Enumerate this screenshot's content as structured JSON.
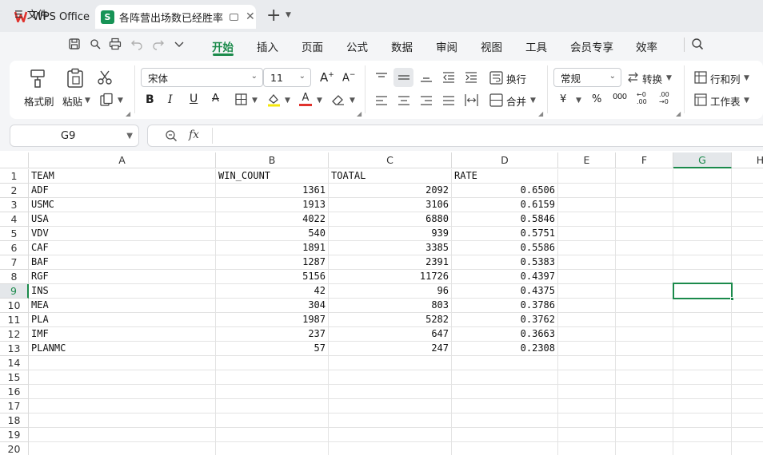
{
  "tabs": {
    "app_label": "WPS Office",
    "doc_label": "各阵营出场数已经胜率",
    "doc_icon_letter": "S"
  },
  "menu": {
    "file_label": "文件",
    "items": [
      "开始",
      "插入",
      "页面",
      "公式",
      "数据",
      "审阅",
      "视图",
      "工具",
      "会员专享",
      "效率"
    ]
  },
  "ribbon": {
    "format_painter": "格式刷",
    "paste": "粘贴",
    "font_name": "宋体",
    "font_size": "11",
    "wrap": "换行",
    "merge": "合并",
    "number_format": "常规",
    "convert": "转换",
    "rows_cols": "行和列",
    "worksheet": "工作表",
    "bold": "B",
    "italic": "I",
    "underline": "U",
    "strike": "A",
    "percent": "%",
    "thousands": "000",
    "currency": "¥",
    "inc_decimal": "←0 .00",
    "dec_decimal": ".00 →0",
    "grow_font": "A",
    "shrink_font": "A",
    "font_color_letter": "A"
  },
  "formula_bar": {
    "cell_ref": "G9",
    "fx": "fx",
    "content": ""
  },
  "sheet": {
    "columns": [
      "A",
      "B",
      "C",
      "D",
      "E",
      "F",
      "G",
      "H"
    ],
    "selected_column": "G",
    "selected_row": 9,
    "row_numbers": [
      "1",
      "2",
      "3",
      "4",
      "5",
      "6",
      "7",
      "8",
      "9",
      "10",
      "11",
      "12",
      "13",
      "14",
      "15",
      "16",
      "17",
      "18",
      "19",
      "20"
    ],
    "header": [
      "TEAM",
      "WIN_COUNT",
      "TOATAL",
      "RATE"
    ],
    "rows": [
      [
        "ADF",
        "1361",
        "2092",
        "0.6506"
      ],
      [
        "USMC",
        "1913",
        "3106",
        "0.6159"
      ],
      [
        "USA",
        "4022",
        "6880",
        "0.5846"
      ],
      [
        "VDV",
        "540",
        "939",
        "0.5751"
      ],
      [
        "CAF",
        "1891",
        "3385",
        "0.5586"
      ],
      [
        "BAF",
        "1287",
        "2391",
        "0.5383"
      ],
      [
        "RGF",
        "5156",
        "11726",
        "0.4397"
      ],
      [
        "INS",
        "42",
        "96",
        "0.4375"
      ],
      [
        "MEA",
        "304",
        "803",
        "0.3786"
      ],
      [
        "PLA",
        "1987",
        "5282",
        "0.3762"
      ],
      [
        "IMF",
        "237",
        "647",
        "0.3663"
      ],
      [
        "PLANMC",
        "57",
        "247",
        "0.2308"
      ]
    ]
  },
  "colors": {
    "accent": "#1b8a4b",
    "wps_red": "#e0322d",
    "sheet_icon": "#179356"
  }
}
